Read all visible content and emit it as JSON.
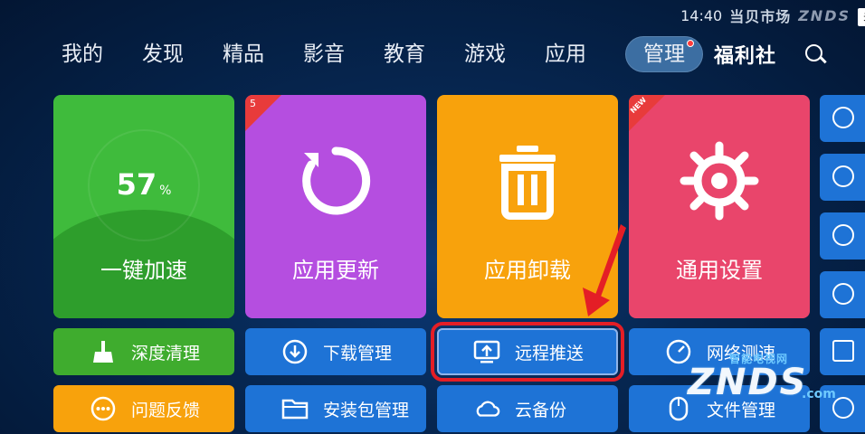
{
  "status_bar": {
    "time": "14:40",
    "brand_cn": "当贝市场",
    "brand_en": "ZNDS",
    "corner_text": "关"
  },
  "nav": {
    "items": [
      "我的",
      "发现",
      "精品",
      "影音",
      "教育",
      "游戏",
      "应用"
    ],
    "active": "管理",
    "fuli": "福利社"
  },
  "tiles": {
    "accel": {
      "percent": "57",
      "percent_sign": "%",
      "label": "一键加速"
    },
    "update": {
      "badge": "5",
      "label": "应用更新"
    },
    "uninstall": {
      "label": "应用卸载"
    },
    "settings": {
      "badge": "NEW",
      "label": "通用设置"
    }
  },
  "buttons": {
    "deep_clean": "深度清理",
    "download_mgr": "下载管理",
    "remote_push": "远程推送",
    "speed_test": "网络测速",
    "feedback": "问题反馈",
    "package_mgr": "安装包管理",
    "cloud_backup": "云备份",
    "file_mgr": "文件管理"
  },
  "watermark": {
    "top": "智能电视网",
    "main": "ZNDS",
    "suffix": ".com"
  },
  "colors": {
    "accent_green": "#3fbb3c",
    "accent_purple": "#b54ee0",
    "accent_orange": "#f8a20c",
    "accent_pink": "#e9456b",
    "button_blue": "#1e73d6",
    "highlight_red": "#e41e26"
  }
}
